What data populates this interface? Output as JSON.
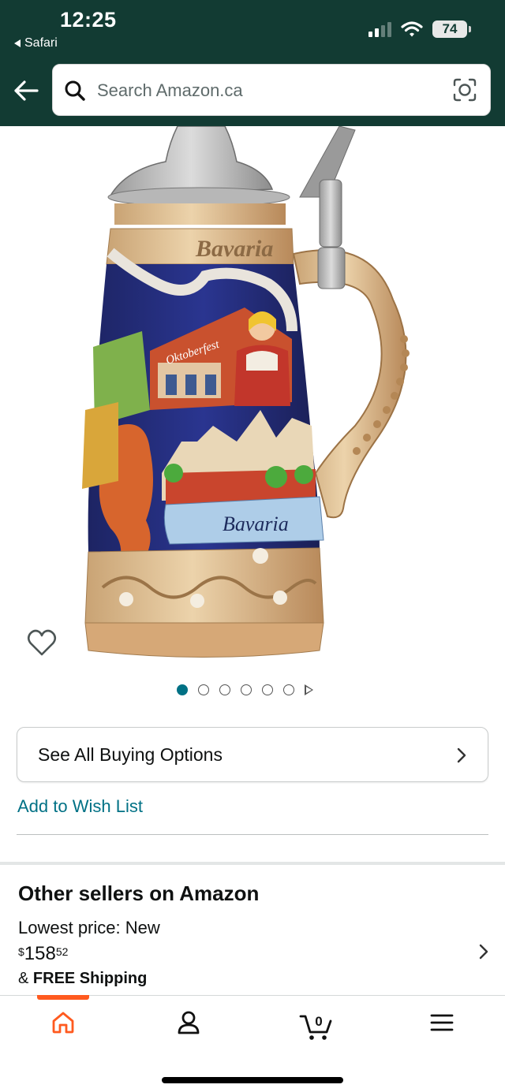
{
  "status_bar": {
    "time": "12:25",
    "back_app": "Safari",
    "battery": "74"
  },
  "header": {
    "background": "#123b33",
    "search_placeholder": "Search Amazon.ca"
  },
  "product": {
    "image_text_top": "Bavaria",
    "image_text_sign": "Oktoberfest",
    "image_text_banner": "Bavaria",
    "gallery_dot_count": 6,
    "active_dot": 1
  },
  "actions": {
    "buying_options_label": "See All Buying Options",
    "wishlist_label": "Add to Wish List"
  },
  "other_sellers": {
    "title": "Other sellers on Amazon",
    "lowest_label": "Lowest price: New",
    "price_symbol": "$",
    "price_whole": "158",
    "price_fraction": "52",
    "shipping_prefix": "& ",
    "shipping_label": "FREE Shipping"
  },
  "bottom_nav": {
    "cart_count": "0",
    "active_color": "#ff5a1f"
  },
  "colors": {
    "link": "#007185",
    "accent": "#ff5a1f"
  }
}
